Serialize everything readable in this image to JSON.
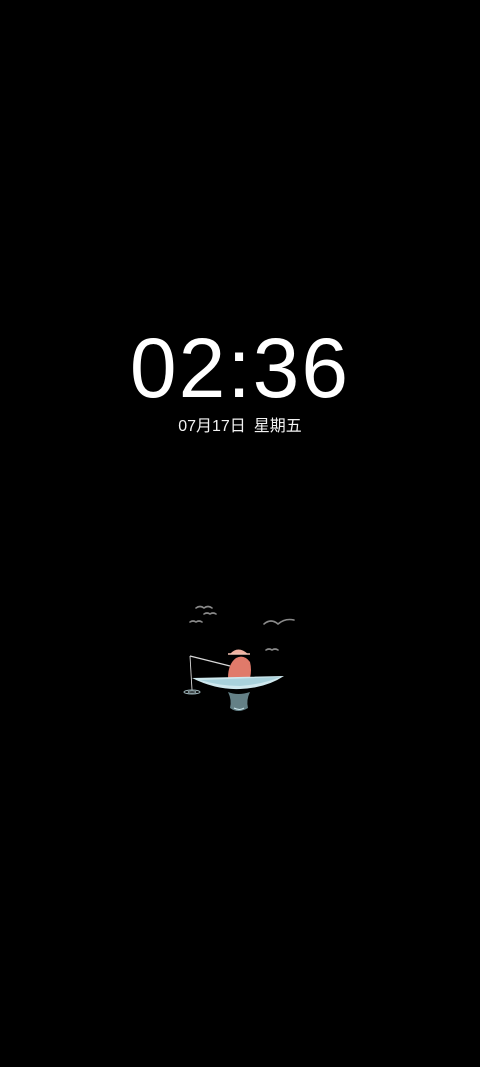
{
  "lock_screen": {
    "time": "02:36",
    "date": "07月17日",
    "weekday": "星期五"
  },
  "artwork": {
    "icon": "fisherman-boat-illustration",
    "colors": {
      "figure": "#e07a6a",
      "boat": "#cfe8ee",
      "birds": "#8a8a8a"
    }
  }
}
